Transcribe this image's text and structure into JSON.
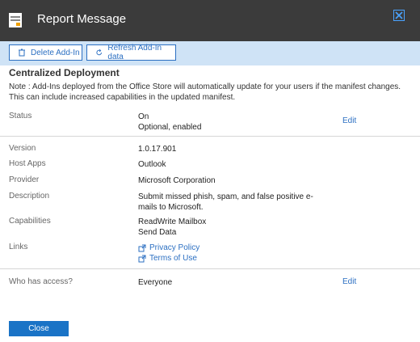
{
  "window": {
    "title": "Report Message"
  },
  "toolbar": {
    "delete_label": "Delete Add-In",
    "refresh_label": "Refresh Add-In data"
  },
  "section": {
    "title": "Centralized Deployment"
  },
  "note": "Note : Add-Ins deployed from the Office Store will automatically update for your users if the manifest changes. This can include increased capabilities in the updated manifest.",
  "status": {
    "label": "Status",
    "line1": "On",
    "line2": "Optional, enabled",
    "edit": "Edit"
  },
  "version": {
    "label": "Version",
    "value": "1.0.17.901"
  },
  "host_apps": {
    "label": "Host Apps",
    "value": "Outlook"
  },
  "provider": {
    "label": "Provider",
    "value": "Microsoft Corporation"
  },
  "description": {
    "label": "Description",
    "line1": "Submit missed phish, spam, and false positive e-",
    "line2": "mails to Microsoft."
  },
  "capabilities": {
    "label": "Capabilities",
    "line1": "ReadWrite Mailbox",
    "line2": "Send Data"
  },
  "links": {
    "label": "Links",
    "privacy": "Privacy Policy",
    "terms": "Terms of Use"
  },
  "access": {
    "label": "Who has access?",
    "value": "Everyone",
    "edit": "Edit"
  },
  "footer": {
    "close_label": "Close"
  },
  "colors": {
    "header_bg": "#3b3b3b",
    "toolbar_bg": "#cfe3f6",
    "accent": "#2b6fc2",
    "primary_button": "#1a73c6"
  },
  "icons": {
    "app": "addin-icon",
    "close": "close-icon",
    "delete": "trash-icon",
    "refresh": "refresh-icon",
    "link": "external-link-icon"
  }
}
